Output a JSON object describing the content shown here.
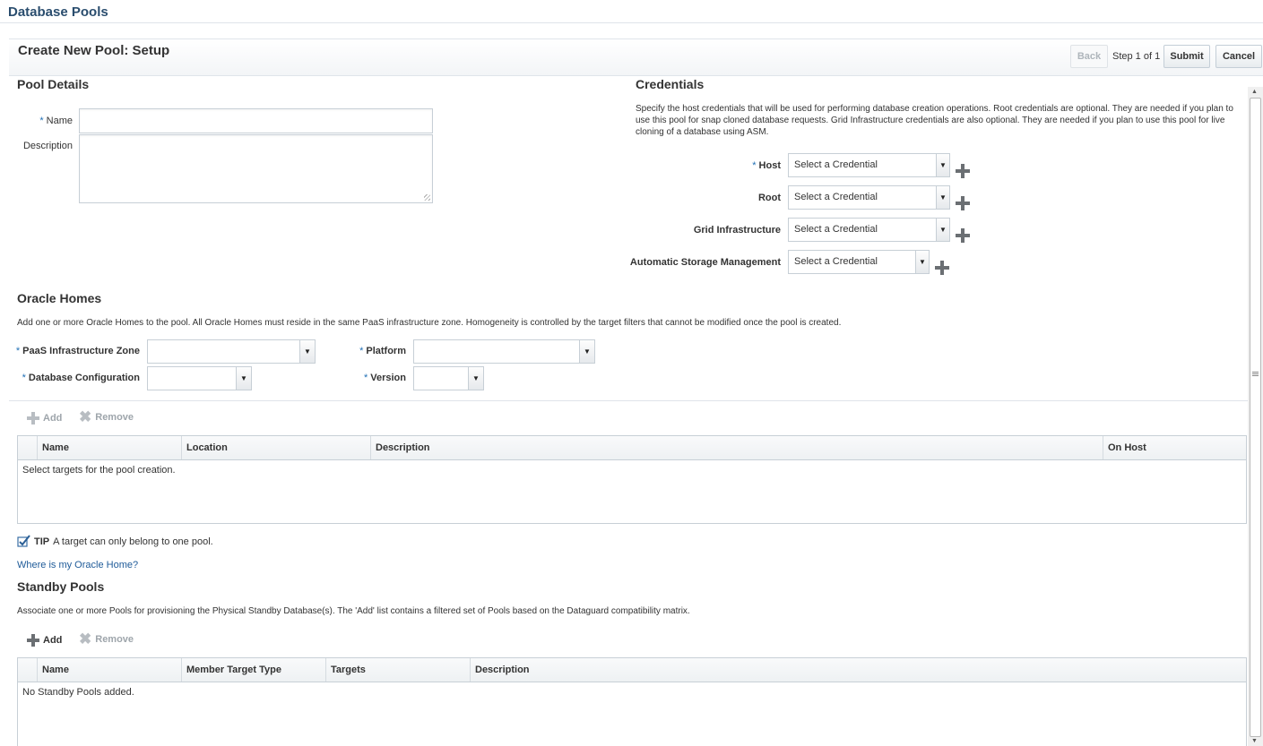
{
  "header": {
    "title": "Database Pools"
  },
  "train": {
    "title": "Create New Pool: Setup",
    "back_label": "Back",
    "step_text": "Step 1 of 1",
    "submit_label": "Submit",
    "cancel_label": "Cancel"
  },
  "pool_details": {
    "heading": "Pool Details",
    "name_label": "Name",
    "name_required": "*",
    "name_value": "",
    "description_label": "Description",
    "description_value": ""
  },
  "credentials": {
    "heading": "Credentials",
    "intro": "Specify the host credentials that will be used for performing database creation operations. Root credentials are optional. They are needed if you plan to use this pool for snap cloned database requests. Grid Infrastructure credentials are also optional. They are needed if you plan to use this pool for live cloning of a database using ASM.",
    "rows": [
      {
        "label": "Host",
        "required": "*",
        "value": "Select a Credential"
      },
      {
        "label": "Root",
        "required": "",
        "value": "Select a Credential"
      },
      {
        "label": "Grid Infrastructure",
        "required": "",
        "value": "Select a Credential"
      },
      {
        "label": "Automatic Storage Management",
        "required": "",
        "value": "Select a Credential"
      }
    ]
  },
  "oracle_homes": {
    "heading": "Oracle Homes",
    "intro": "Add one or more Oracle Homes to the pool. All Oracle Homes must reside in the same PaaS infrastructure zone. Homogeneity is controlled by the target filters that cannot be modified once the pool is created.",
    "paas_zone_label": "PaaS Infrastructure Zone",
    "paas_zone_value": "",
    "platform_label": "Platform",
    "platform_value": "",
    "db_config_label": "Database Configuration",
    "db_config_value": "",
    "version_label": "Version",
    "version_value": "",
    "required": "*",
    "add_label": "Add",
    "remove_label": "Remove",
    "columns": [
      "Name",
      "Location",
      "Description",
      "On Host"
    ],
    "empty_message": "Select targets for the pool creation.",
    "tip_label": "TIP",
    "tip_text": "A target can only belong to one pool.",
    "help_link": "Where is my Oracle Home?"
  },
  "standby_pools": {
    "heading": "Standby Pools",
    "intro": "Associate one or more Pools for provisioning the Physical Standby Database(s). The 'Add' list contains a filtered set of Pools based on the Dataguard compatibility matrix.",
    "add_label": "Add",
    "remove_label": "Remove",
    "columns": [
      "Name",
      "Member Target Type",
      "Targets",
      "Description"
    ],
    "empty_message": "No Standby Pools added."
  },
  "colors": {
    "title": "#2a4d6e",
    "link": "#1f5b99",
    "required": "#1f6fb5"
  }
}
